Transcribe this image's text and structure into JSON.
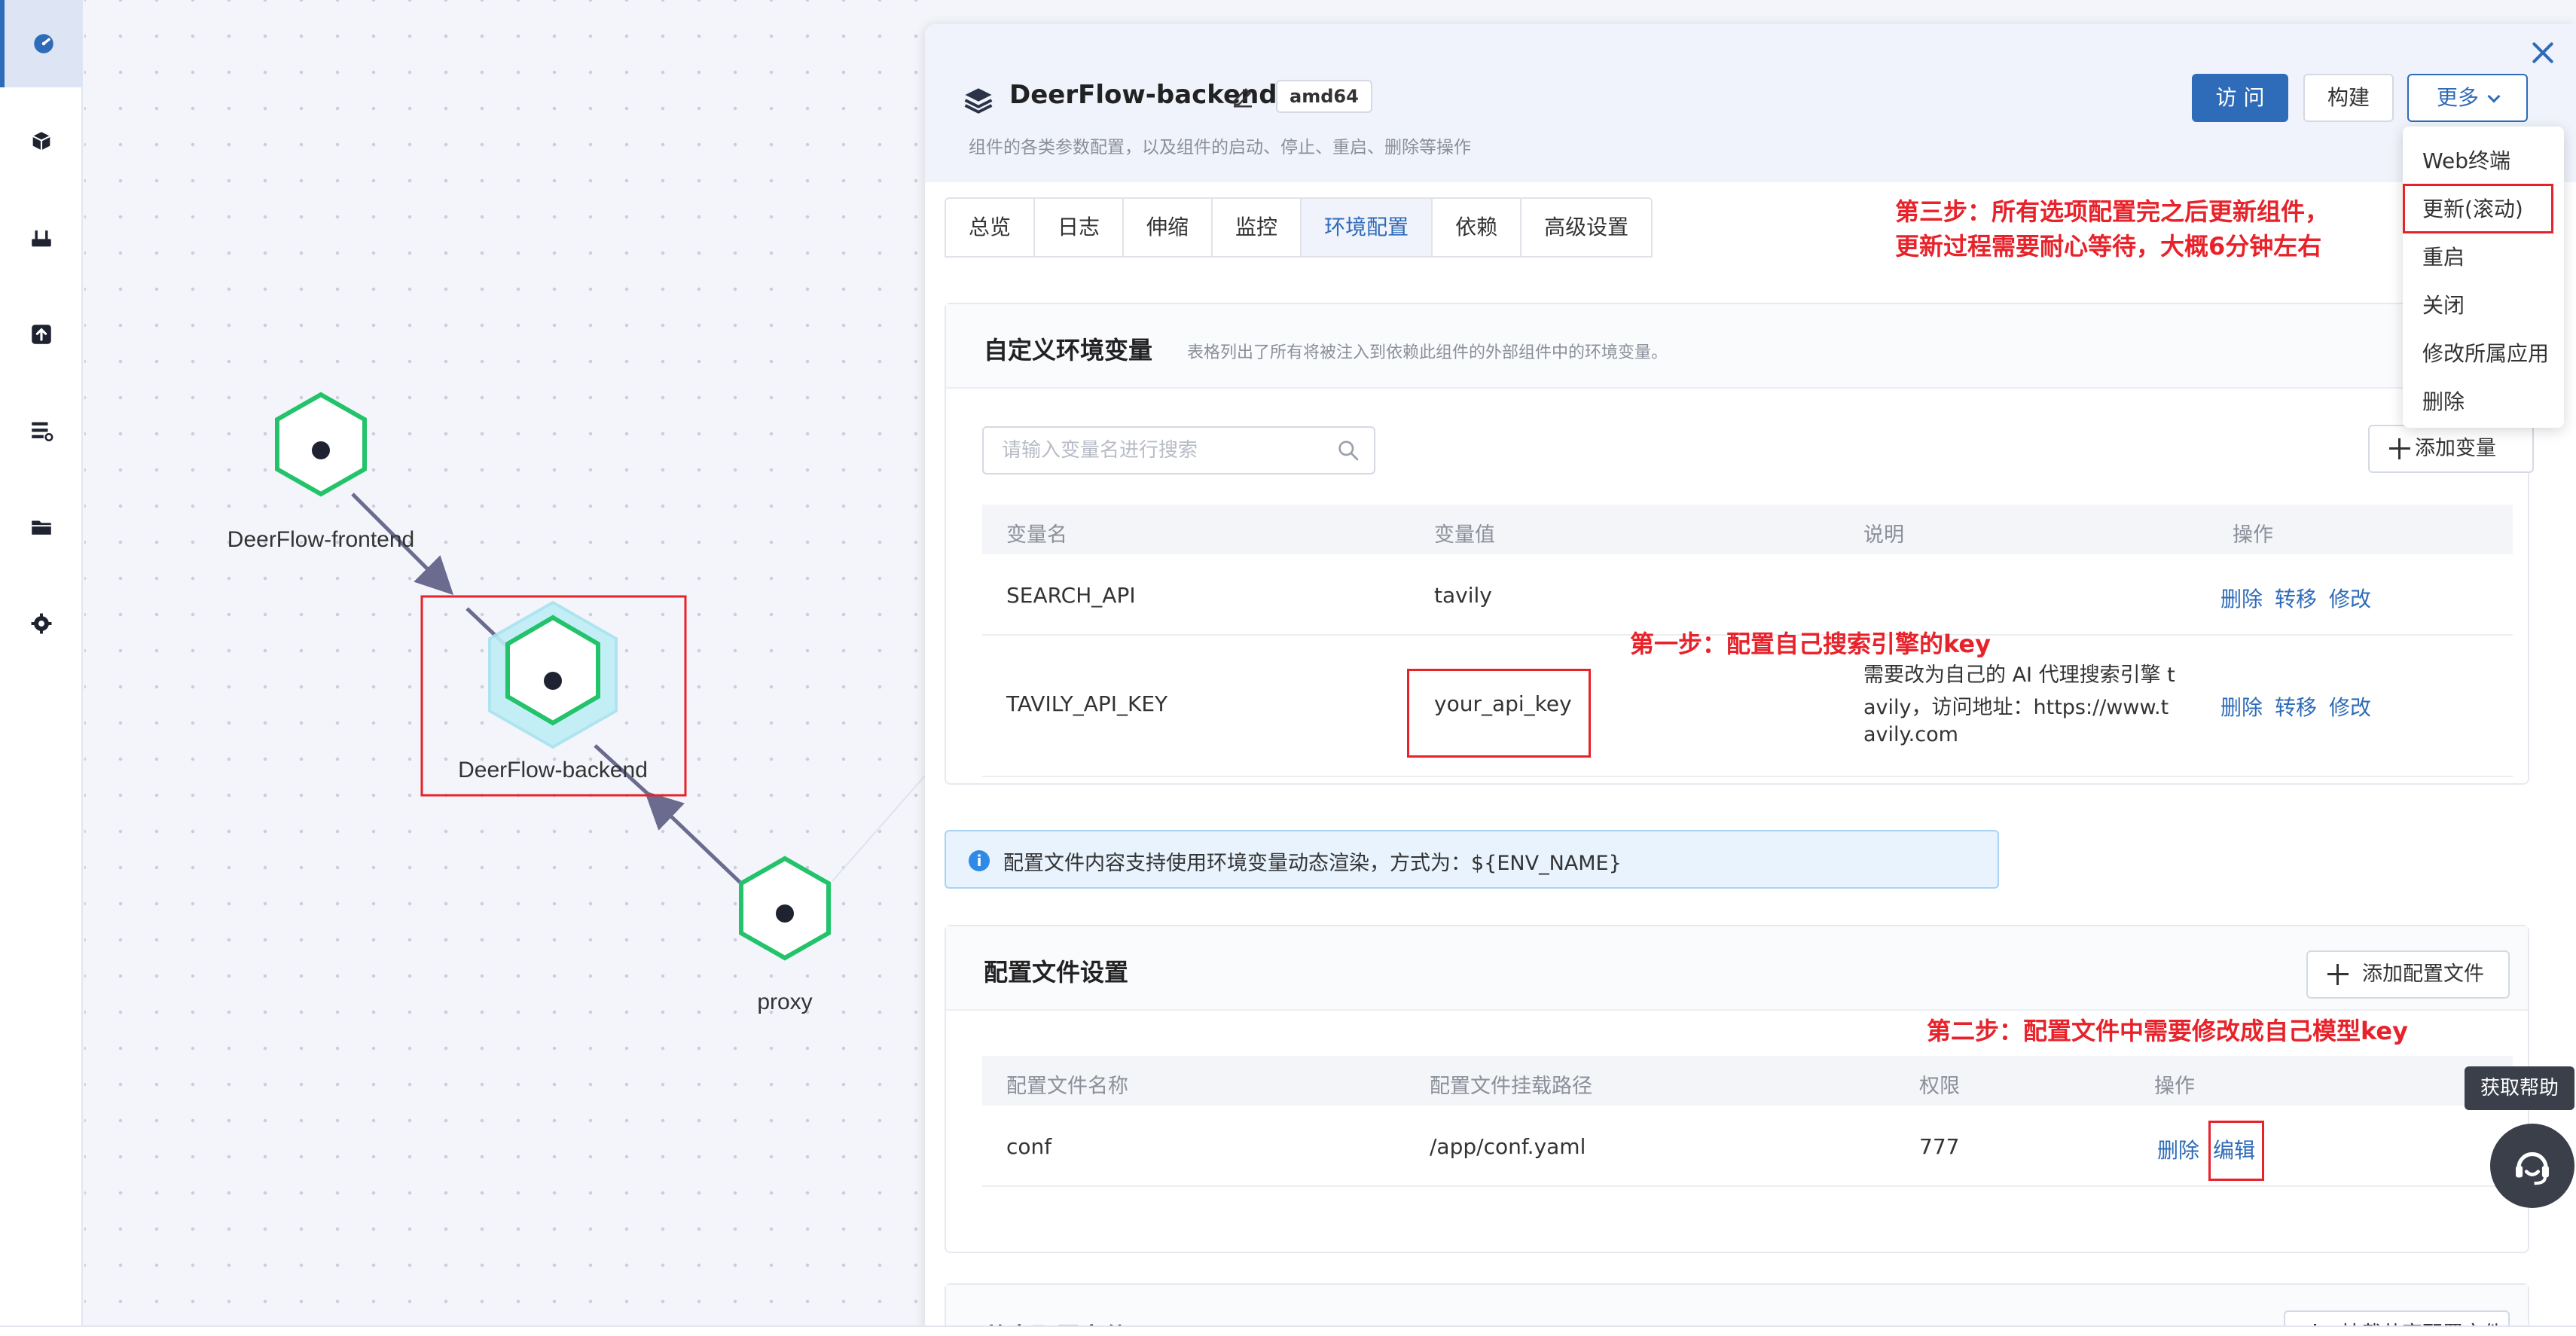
{
  "colors": {
    "accent": "#2e6bb8",
    "annotation": "#e8222a",
    "node": "#22c36a",
    "edge": "#6b6b90"
  },
  "sidebar": {
    "items": [
      {
        "icon": "dashboard-icon",
        "active": true
      },
      {
        "icon": "cube-icon"
      },
      {
        "icon": "plugin-icon"
      },
      {
        "icon": "upload-icon"
      },
      {
        "icon": "server-list-icon"
      },
      {
        "icon": "folder-icon"
      },
      {
        "icon": "gear-icon"
      }
    ]
  },
  "topology": {
    "nodes": [
      {
        "label": "DeerFlow-frontend"
      },
      {
        "label": "DeerFlow-backend",
        "selected": true
      },
      {
        "label": "proxy"
      }
    ]
  },
  "header": {
    "title": "DeerFlow-backend",
    "arch": "amd64",
    "subtitle": "组件的各类参数配置，以及组件的启动、停止、重启、删除等操作",
    "visit_label": "访 问",
    "build_label": "构建",
    "more_label": "更多"
  },
  "more_menu": {
    "items": [
      "Web终端",
      "更新(滚动)",
      "重启",
      "关闭",
      "修改所属应用",
      "删除"
    ]
  },
  "tabs": [
    {
      "label": "总览"
    },
    {
      "label": "日志"
    },
    {
      "label": "伸缩"
    },
    {
      "label": "监控"
    },
    {
      "label": "环境配置",
      "active": true
    },
    {
      "label": "依赖"
    },
    {
      "label": "高级设置"
    }
  ],
  "env_vars": {
    "title": "自定义环境变量",
    "description": "表格列出了所有将被注入到依赖此组件的外部组件中的环境变量。",
    "search_placeholder": "请输入变量名进行搜索",
    "add_label": "添加变量",
    "columns": [
      "变量名",
      "变量值",
      "说明",
      "操作"
    ],
    "rows": [
      {
        "name": "SEARCH_API",
        "value": "tavily",
        "desc_lines": [],
        "actions": [
          "删除",
          "转移",
          "修改"
        ]
      },
      {
        "name": "TAVILY_API_KEY",
        "value": "your_api_key",
        "desc_lines": [
          "需要改为自己的 AI 代理搜索引擎 t",
          "avily，访问地址：https://www.t",
          "avily.com"
        ],
        "actions": [
          "删除",
          "转移",
          "修改"
        ]
      }
    ]
  },
  "info_banner": {
    "icon": "info-icon",
    "text": "配置文件内容支持使用环境变量动态渲染，方式为：${ENV_NAME}"
  },
  "config_files": {
    "title": "配置文件设置",
    "add_label": "添加配置文件",
    "columns": [
      "配置文件名称",
      "配置文件挂载路径",
      "权限",
      "操作"
    ],
    "rows": [
      {
        "name": "conf",
        "path": "/app/conf.yaml",
        "perm": "777",
        "actions": [
          "删除",
          "编辑"
        ]
      }
    ]
  },
  "shared_config": {
    "title": "共享配置文件",
    "mount_label": "挂载共享配置文件"
  },
  "annotations": {
    "step1": "第一步：配置自己搜索引擎的key",
    "step2": "第二步：配置文件中需要修改成自己模型key",
    "step3_line1": "第三步：所有选项配置完之后更新组件，",
    "step3_line2": "更新过程需要耐心等待，大概6分钟左右"
  },
  "help": {
    "tooltip": "获取帮助",
    "icon": "headset-icon"
  }
}
